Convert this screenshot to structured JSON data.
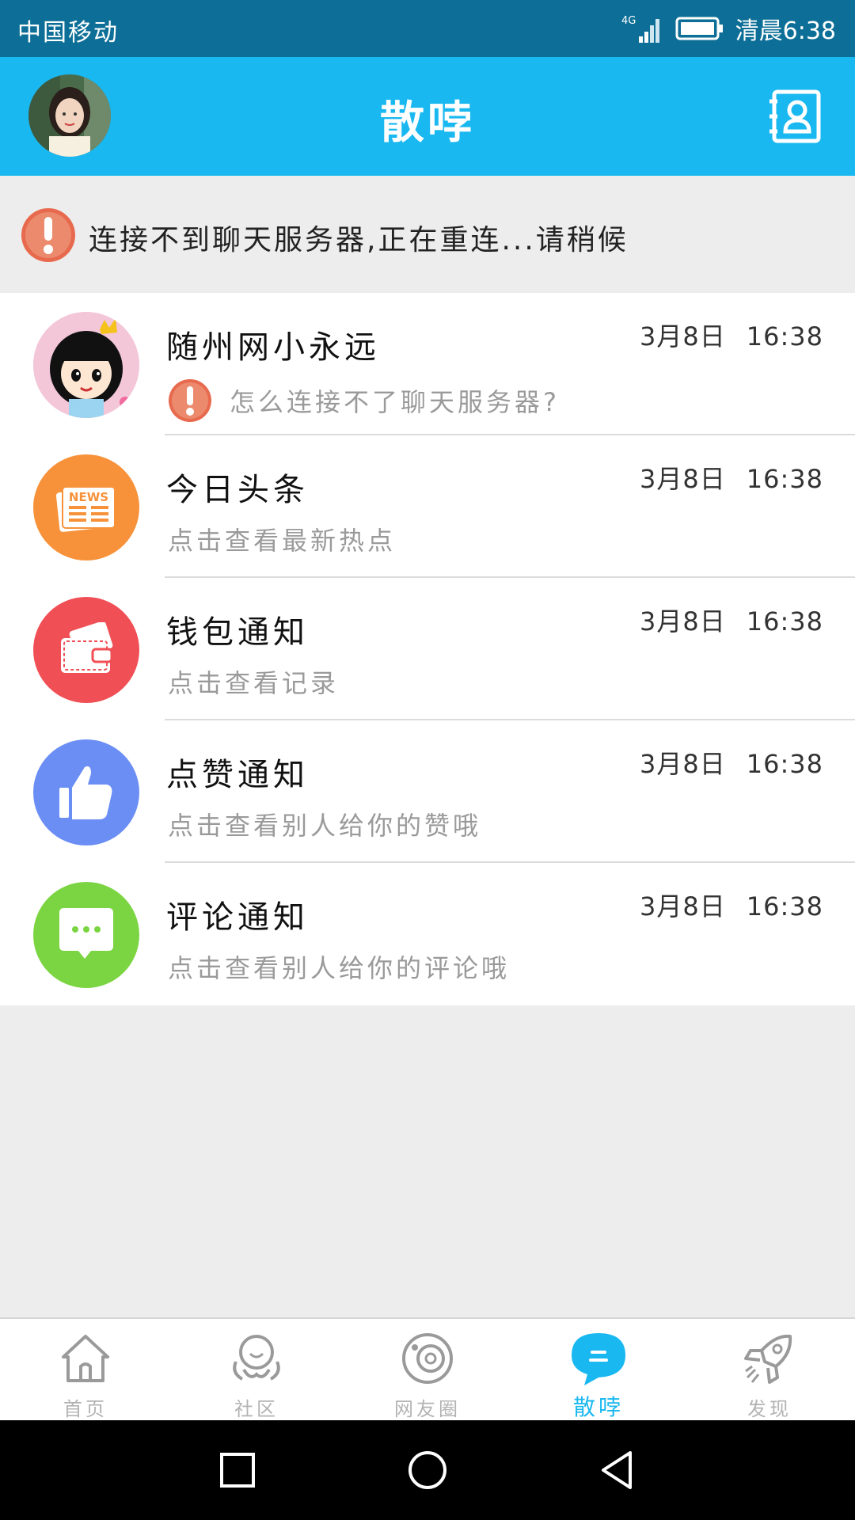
{
  "status_bar": {
    "carrier": "中国移动",
    "network": "4G",
    "time": "清晨6:38",
    "icons": [
      "signal-icon",
      "battery-icon"
    ]
  },
  "app_bar": {
    "title": "散哱",
    "avatar": "user-avatar",
    "right_icon": "contacts-icon"
  },
  "banner": {
    "icon": "alert-icon",
    "text": "连接不到聊天服务器,正在重连...请稍候"
  },
  "conversations": [
    {
      "title": "随州网小永远",
      "subtitle": "怎么连接不了聊天服务器?",
      "date": "3月8日",
      "time": "16:38",
      "icon": "cartoon-girl-avatar",
      "has_error": true
    },
    {
      "title": "今日头条",
      "subtitle": "点击查看最新热点",
      "date": "3月8日",
      "time": "16:38",
      "icon": "news-icon",
      "icon_text": "NEWS",
      "color": "#f7923a"
    },
    {
      "title": "钱包通知",
      "subtitle": "点击查看记录",
      "date": "3月8日",
      "time": "16:38",
      "icon": "wallet-icon",
      "color": "#f04f55"
    },
    {
      "title": "点赞通知",
      "subtitle": "点击查看别人给你的赞哦",
      "date": "3月8日",
      "time": "16:38",
      "icon": "thumbs-up-icon",
      "color": "#6b8ef5"
    },
    {
      "title": "评论通知",
      "subtitle": "点击查看别人给你的评论哦",
      "date": "3月8日",
      "time": "16:38",
      "icon": "comment-icon",
      "color": "#7bd542"
    }
  ],
  "tabs": [
    {
      "label": "首页",
      "icon": "home-icon",
      "active": false
    },
    {
      "label": "社区",
      "icon": "community-icon",
      "active": false
    },
    {
      "label": "网友圈",
      "icon": "moments-icon",
      "active": false
    },
    {
      "label": "散哱",
      "icon": "chat-bubble-icon",
      "active": true
    },
    {
      "label": "发现",
      "icon": "rocket-icon",
      "active": false
    }
  ],
  "colors": {
    "status_bar": "#0d6f97",
    "app_bar": "#1ab8f0",
    "accent": "#1ab8f0"
  }
}
